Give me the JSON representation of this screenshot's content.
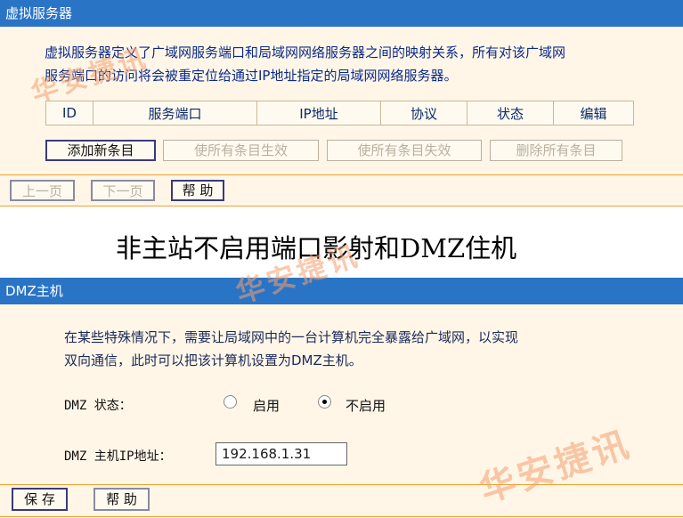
{
  "virtual_server": {
    "title": "虚拟服务器",
    "description_line1": "虚拟服务器定义了广域网服务端口和局域网网络服务器之间的映射关系，所有对该广域网",
    "description_line2": "服务端口的访问将会被重定位给通过IP地址指定的局域网网络服务器。",
    "table_headers": [
      "ID",
      "服务端口",
      "IP地址",
      "协议",
      "状态",
      "编辑"
    ],
    "buttons": {
      "add": "添加新条目",
      "enable_all": "使所有条目生效",
      "disable_all": "使所有条目失效",
      "delete_all": "删除所有条目"
    },
    "nav": {
      "prev": "上一页",
      "next": "下一页",
      "help": "帮 助"
    }
  },
  "heading": "非主站不启用端口影射和DMZ住机",
  "dmz": {
    "title": "DMZ主机",
    "description_line1": "在某些特殊情况下，需要让局域网中的一台计算机完全暴露给广域网，以实现",
    "description_line2": "双向通信，此时可以把该计算机设置为DMZ主机。",
    "status_label": "DMZ 状态：",
    "option_enable": "启用",
    "option_disable": "不启用",
    "selected": "不启用",
    "ip_label": "DMZ 主机IP地址：",
    "ip_value": "192.168.1.31",
    "save": "保 存",
    "help": "帮 助"
  },
  "watermark": "华安捷讯",
  "colors": {
    "title_bar": "#2a74c6",
    "panel": "#fff6e7",
    "separator": "#f0a030"
  }
}
